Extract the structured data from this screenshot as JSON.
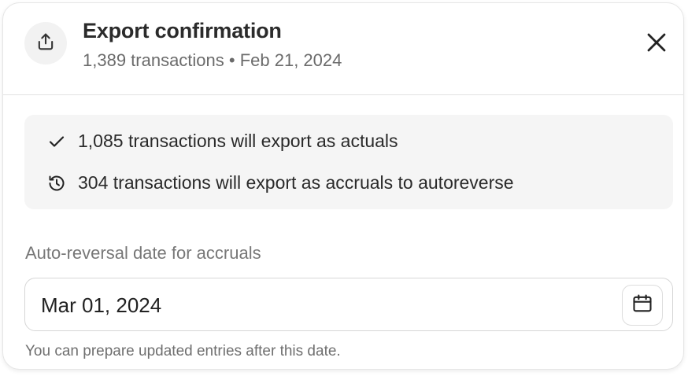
{
  "dialog": {
    "title": "Export confirmation",
    "subtitle": "1,389 transactions • Feb 21, 2024",
    "header_icon": "upload-export-icon",
    "close_icon": "close-icon"
  },
  "summary": {
    "actuals": {
      "icon": "checkmark-icon",
      "text": "1,085 transactions will export as actuals"
    },
    "accruals": {
      "icon": "history-icon",
      "text": "304 transactions will export as accruals to autoreverse"
    }
  },
  "reversal_date": {
    "label": "Auto-reversal date for accruals",
    "value": "Mar 01, 2024",
    "calendar_icon": "calendar-icon",
    "helper": "You can prepare updated entries after this date."
  }
}
